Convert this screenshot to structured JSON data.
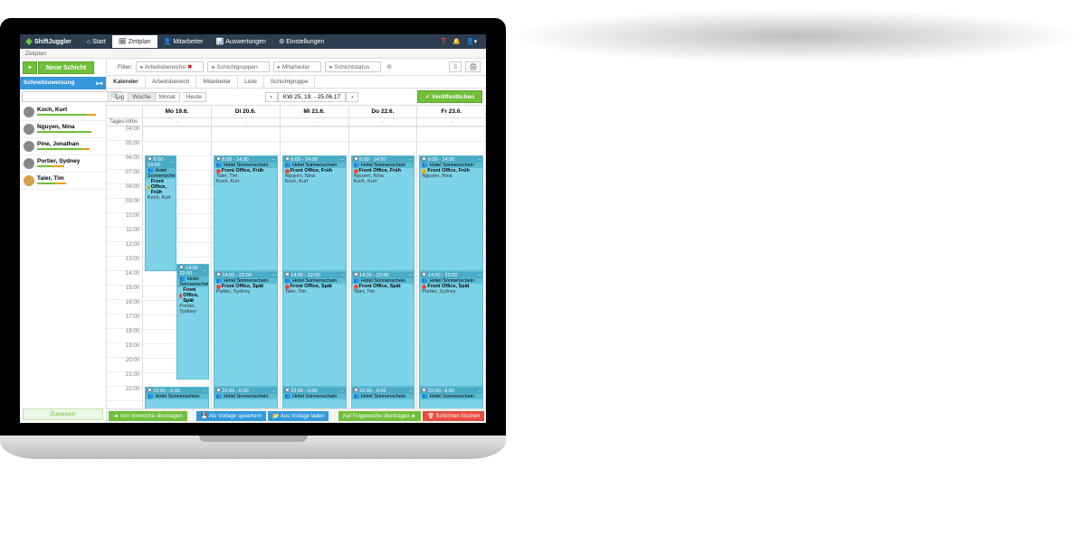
{
  "app": "ShiftJuggler",
  "nav": {
    "start": "Start",
    "zeitplan": "Zeitplan",
    "mitarbeiter": "Mitarbeiter",
    "auswertungen": "Auswertungen",
    "einstellungen": "Einstellungen"
  },
  "crumb": "Zeitplan",
  "newshift": "Neue Schicht",
  "filter": {
    "label": "Filter:",
    "arbeitsbereiche": "Arbeitsbereiche",
    "schichtgruppen": "Schichtgruppen",
    "mitarbeiter": "Mitarbeiter",
    "schichtstatus": "Schichtstatus"
  },
  "sidebar": {
    "title": "Schnellzuweisung",
    "search_placeholder": "",
    "employees": [
      {
        "name": "Koch, Kurt"
      },
      {
        "name": "Nguyen, Nina"
      },
      {
        "name": "Pine, Jonathan"
      },
      {
        "name": "Portier, Sydney"
      },
      {
        "name": "Taler, Tim"
      }
    ],
    "done": "Zuweisen"
  },
  "tabs": {
    "kalender": "Kalender",
    "arbeitsbereich": "Arbeitsbereich",
    "mitarbeiter": "Mitarbeiter",
    "liste": "Liste",
    "schichtgruppe": "Schichtgruppe"
  },
  "view": {
    "tag": "Tag",
    "woche": "Woche",
    "monat": "Monat",
    "heute": "Heute",
    "week_label": "KW 25, 19. - 25.06.17",
    "publish": "Veröffentlichen"
  },
  "cal": {
    "tagesinfo": "Tages-Infos",
    "days": [
      "Mo 19.6.",
      "Di 20.6.",
      "Mi 21.6.",
      "Do 22.6.",
      "Fr 23.6."
    ],
    "hours": [
      "04:00",
      "05:00",
      "06:00",
      "07:00",
      "08:00",
      "09:00",
      "10:00",
      "11:00",
      "12:00",
      "13:00",
      "14:00",
      "15:00",
      "16:00",
      "17:00",
      "18:00",
      "19:00",
      "20:00",
      "21:00",
      "22:00"
    ],
    "shifts": {
      "morning_time": "6:00 - 14:00",
      "afternoon_time": "14:00 - 22:00",
      "night_time": "22:00 - 6:00",
      "hotel": "Hotel Sonnenschein",
      "role_frueh": "Front Office, Früh",
      "role_spaet": "Front Office, Spät",
      "emp_koch": "Koch, Kurt",
      "emp_taler": "Taler, Tim",
      "emp_nguyen": "Nguyen, Nina",
      "emp_portier": "Portier, Sydney"
    }
  },
  "footer": {
    "vorwoche": "Von Vorwoche übertragen",
    "vorlage_speichern": "Als Vorlage speichern",
    "vorlage_laden": "Aus Vorlage laden",
    "folgewoche": "Auf Folgewoche übertragen",
    "loeschen": "Schichten löschen"
  }
}
